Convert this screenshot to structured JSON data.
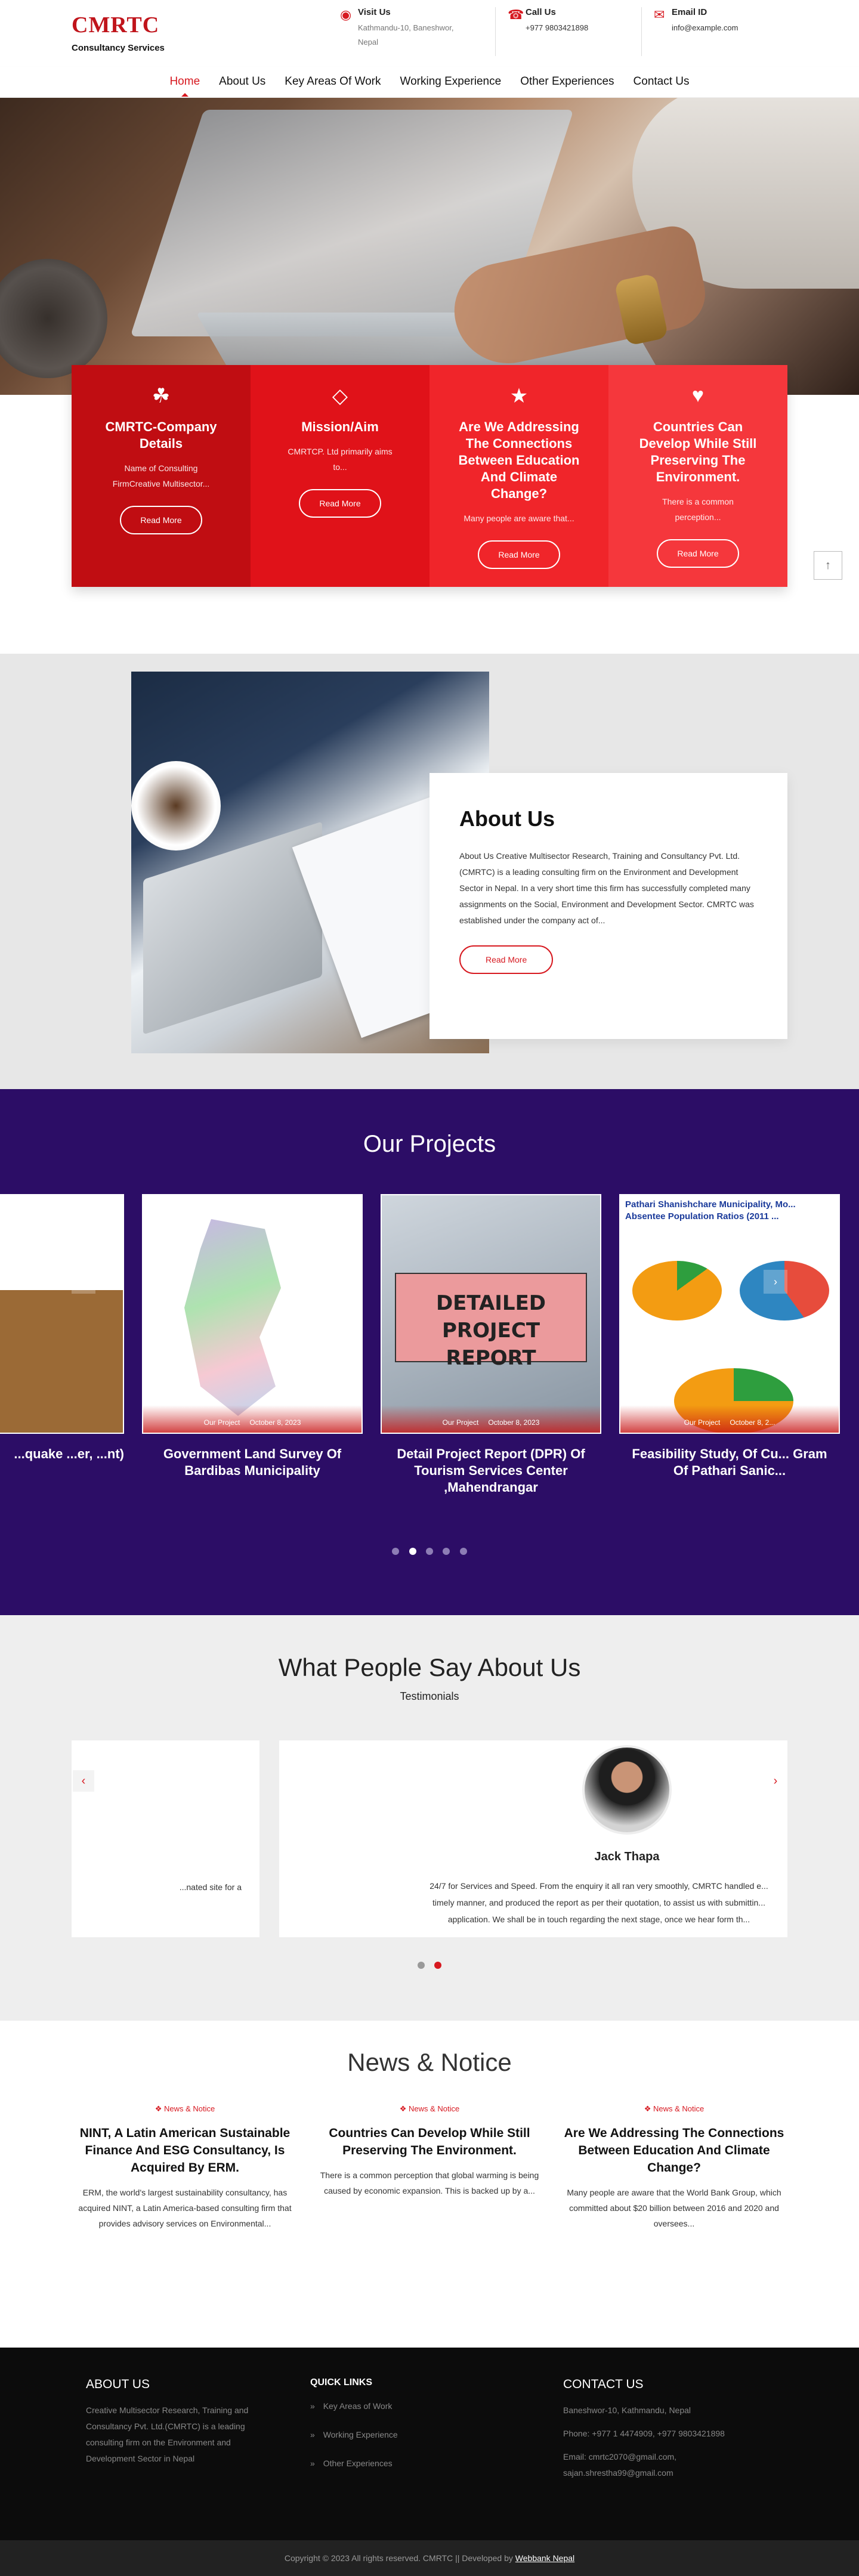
{
  "header": {
    "brand": "CMRTC",
    "tagline": "Consultancy Services",
    "visit": {
      "label": "Visit Us",
      "value": "Kathmandu-10, Baneshwor, Nepal"
    },
    "call": {
      "label": "Call Us",
      "value": "+977 9803421898"
    },
    "email": {
      "label": "Email ID",
      "value": "info@example.com"
    }
  },
  "nav": [
    "Home",
    "About Us",
    "Key Areas Of Work",
    "Working Experience",
    "Other Experiences",
    "Contact Us"
  ],
  "services": [
    {
      "icon": "leaf-icon",
      "title": "CMRTC-Company Details",
      "text": "Name of Consulting FirmCreative Multisector...",
      "button": "Read More"
    },
    {
      "icon": "diamond-icon",
      "title": "Mission/Aim",
      "text": "CMRTCP. Ltd primarily aims to...",
      "button": "Read More"
    },
    {
      "icon": "star-icon",
      "title": "Are We Addressing The Connections Between Education And Climate Change?",
      "text": "Many people are aware that...",
      "button": "Read More"
    },
    {
      "icon": "heart-icon",
      "title": "Countries Can Develop While Still Preserving The Environment.",
      "text": "There is a common perception...",
      "button": "Read More"
    }
  ],
  "back_to_top": "↑",
  "about": {
    "title": "About Us",
    "text": "About Us Creative Multisector Research, Training and Consultancy Pvt. Ltd.(CMRTC) is a leading consulting firm on the Environment and Development Sector in Nepal. In a very short time this firm has successfully completed many assignments on the Social, Environment and Development Sector. CMRTC was established under the company act of...",
    "button": "Read More"
  },
  "projects": {
    "title": "Our Projects",
    "items": [
      {
        "title": "...quake ...er, ...nt)",
        "category": "",
        "date": ""
      },
      {
        "title": "Government Land Survey Of Bardibas Municipality",
        "category": "Our Project",
        "date": "October 8, 2023"
      },
      {
        "title": "Detail Project Report (DPR) Of Tourism Services Center ,Mahendrangar",
        "category": "Our Project",
        "date": "October 8, 2023",
        "image_text": "DETAILED PROJECT REPORT"
      },
      {
        "title": "Feasibility Study, Of Cu... Gram Of Pathari Sanic...",
        "category": "Our Project",
        "date": "October 8, 2...",
        "image_text": "Pathari Shanishchare Municipality, Mo... Absentee Population Ratios (2011 ..."
      }
    ],
    "dots": 5,
    "active_dot": 1
  },
  "testimonials": {
    "title": "What People Say About Us",
    "subtitle": "Testimonials",
    "left_quote": "...nated site for a",
    "name": "Jack Thapa",
    "quote_lines": [
      "24/7 for Services and Speed. From the enquiry it all ran very smoothly, CMRTC handled e...",
      "timely manner, and produced the report as per their quotation, to assist us with submittin...",
      "application. We shall be in touch regarding the next stage, once we hear form th..."
    ],
    "dots": 2,
    "active_dot": 1
  },
  "news": {
    "title": "News & Notice",
    "items": [
      {
        "tag": "News & Notice",
        "title": "NINT, A Latin American Sustainable Finance And ESG Consultancy, Is Acquired By ERM.",
        "text": "ERM, the world's largest sustainability consultancy, has acquired NINT, a Latin America-based consulting firm that provides advisory services on Environmental..."
      },
      {
        "tag": "News & Notice",
        "title": "Countries Can Develop While Still Preserving The Environment.",
        "text": "There is a common perception that global warming is being caused by economic expansion. This is backed up by a..."
      },
      {
        "tag": "News & Notice",
        "title": "Are We Addressing The Connections Between Education And Climate Change?",
        "text": "Many people are aware that the World Bank Group, which committed about $20 billion between 2016 and 2020 and oversees..."
      }
    ]
  },
  "footer": {
    "about_title": "ABOUT US",
    "about_text": "Creative Multisector Research, Training and Consultancy Pvt. Ltd.(CMRTC) is a leading consulting firm on the Environment and Development Sector in Nepal",
    "links_title": "QUICK LINKS",
    "links": [
      "Key Areas of Work",
      "Working Experience",
      "Other Experiences"
    ],
    "contact_title": "CONTACT US",
    "address": "Baneshwor-10, Kathmandu, Nepal",
    "phone": "Phone: +977 1 4474909, +977 9803421898",
    "email": "Email: cmrtc2070@gmail.com, sajan.shrestha99@gmail.com",
    "copyright": "Copyright © 2023 All rights reserved. CMRTC || Developed by ",
    "developer": "Webbank Nepal"
  }
}
